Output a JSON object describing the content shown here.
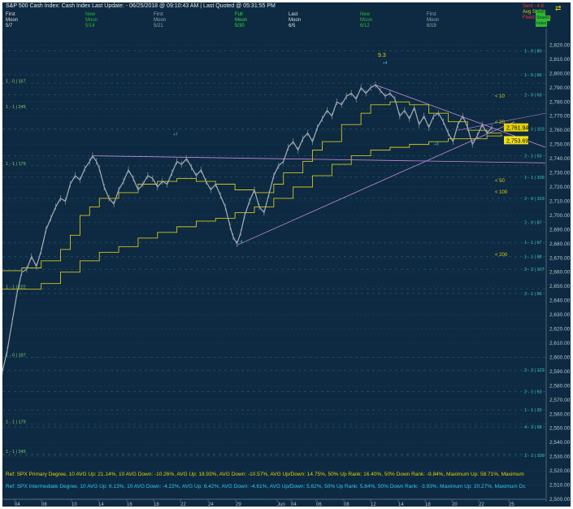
{
  "header": {
    "title": "S&P 500 Cash Index:  Cash Index  Last Update:  - 06/25/2018 @ 09:10:43 AM | Last Quoted @ 05:31:55 PM",
    "moon_phases": [
      {
        "top": "First",
        "bottom": "Moon",
        "date": "5/7",
        "color": "#e0e0e0"
      },
      {
        "top": "New",
        "bottom": "Moon",
        "date": "5/14",
        "color": "#2eb82e"
      },
      {
        "top": "First",
        "bottom": "Moon",
        "date": "5/21",
        "color": "#9aa4ad"
      },
      {
        "top": "Full",
        "bottom": "Moon",
        "date": "5/30",
        "color": "#33dd33"
      },
      {
        "top": "Last",
        "bottom": "Moon",
        "date": "6/5",
        "color": "#e0e0e0"
      },
      {
        "top": "New",
        "bottom": "Moon",
        "date": "6/12",
        "color": "#2eb82e"
      },
      {
        "top": "First",
        "bottom": "Moon",
        "date": "6/19",
        "color": "#9aa4ad"
      }
    ],
    "legend": [
      {
        "label": "Sent - 4.8",
        "color": "#ff3333"
      },
      {
        "label": "Avg  Shift",
        "color": "#e6d200"
      },
      {
        "label": "Fixed Shares",
        "color": "#ff3333"
      }
    ],
    "legend_badges": [
      "Shift",
      "Shares",
      "Index"
    ]
  },
  "annotations": {
    "peak_label": "9.3",
    "marker_high": "+4",
    "marker_left": "+7",
    "marker_low": "-4",
    "marker_right": "+3",
    "ma_labels": [
      "< 10",
      "< 20",
      "< 50",
      "< 100",
      "< 200"
    ]
  },
  "levels": [
    {
      "label": "1 - 0 | 80",
      "price": 2816
    },
    {
      "label": "1 - 0 | 66",
      "price": 2799
    },
    {
      "label": "2 - 0 | 63",
      "price": 2785
    },
    {
      "label": "2 - 1 | 102",
      "price": 2761
    },
    {
      "label": "2 - 1 | 53",
      "price": 2742
    },
    {
      "label": "1 - 1 | 106",
      "price": 2727
    },
    {
      "label": "2 - 0 | 103",
      "price": 2712
    },
    {
      "label": "2 - 0 | 87",
      "price": 2695
    },
    {
      "label": "1 - 1 | 67",
      "price": 2681
    },
    {
      "label": "1 - 1 | 88",
      "price": 2671
    },
    {
      "label": "2 - 2 | 107",
      "price": 2662
    },
    {
      "label": "2 - 1 | 56",
      "price": 2645
    },
    {
      "label": "2 - 2 | 122",
      "price": 2591
    },
    {
      "label": "2 - 1 | 63",
      "price": 2576
    },
    {
      "label": "1 - 1 | 33",
      "price": 2563
    },
    {
      "label": "4 - 3 | 58",
      "price": 2551
    },
    {
      "label": "1 - 1 | 106",
      "price": 2531
    }
  ],
  "left_levels": [
    {
      "label": "1 - 0 | 167",
      "price": 2793
    },
    {
      "label": "1 - 1 | 245",
      "price": 2775
    },
    {
      "label": "1 - 1 | 179",
      "price": 2735
    },
    {
      "label": "1 - 1 | 222",
      "price": 2648
    },
    {
      "label": "1 - 0 | 197",
      "price": 2600
    },
    {
      "label": "1 - 1 | 179",
      "price": 2553
    },
    {
      "label": "1 - 1 | 245",
      "price": 2532
    }
  ],
  "stats": {
    "primary": "Ref: SPX Primary Degree, 10 AVG Up: 21.14%, 10 AVG Down: -10.26%, AVG Up: 18.93%, AVG Down: -10.57%, AVG Up/Down: 14.75%, 50%  Up Rank: 16.40%, 50% Down Rank: -9.84%, Maximum Up: 58.71%, Maximum",
    "intermediate": "Ref: SPX Intermediate Degree, 10 AVG Up: 6.13%, 10 AVG Down: -4.22%, AVG Up: 6.42%, AVG Down: -4.61%, AVG Up/Down: 5.62%, 50%  Up Rank: 5.84%, 50% Down Rank: -3.93%, Maximum Up: 20.27%, Maximum Dc"
  },
  "chart_data": {
    "type": "line",
    "title": "S&P 500 Cash Index",
    "xlabel": "",
    "ylabel": "",
    "ylim": [
      2500,
      2830
    ],
    "y_ticks": [
      "2,820.00",
      "2,810.00",
      "2,800.00",
      "2,790.00",
      "2,780.00",
      "2,770.00",
      "2,760.00",
      "2,750.00",
      "2,740.00",
      "2,730.00",
      "2,720.00",
      "2,710.00",
      "2,700.00",
      "2,690.00",
      "2,680.00",
      "2,670.00",
      "2,660.00",
      "2,650.00",
      "2,640.00",
      "2,630.00",
      "2,620.00",
      "2,610.00",
      "2,600.00",
      "2,590.00",
      "2,580.00",
      "2,570.00",
      "2,560.00",
      "2,550.00",
      "2,540.00",
      "2,530.00",
      "2,520.00",
      "2,510.00",
      "2,500.00"
    ],
    "x_ticks": [
      "04",
      "08",
      "10",
      "14",
      "16",
      "18",
      "22",
      "24",
      "29",
      "Jun",
      "04",
      "06",
      "08",
      "12",
      "14",
      "18",
      "20",
      "22",
      "25"
    ],
    "price_labels": {
      "last": "2,761.94",
      "ma": "2,753.69"
    },
    "price_path": [
      [
        0,
        2590
      ],
      [
        0.5,
        2605
      ],
      [
        1,
        2625
      ],
      [
        1.5,
        2645
      ],
      [
        2,
        2660
      ],
      [
        2.5,
        2662
      ],
      [
        3,
        2671
      ],
      [
        3.5,
        2664
      ],
      [
        4,
        2675
      ],
      [
        4.5,
        2690
      ],
      [
        5,
        2698
      ],
      [
        5.5,
        2706
      ],
      [
        6,
        2712
      ],
      [
        6.5,
        2710
      ],
      [
        7,
        2722
      ],
      [
        7.5,
        2728
      ],
      [
        8,
        2725
      ],
      [
        8.5,
        2733
      ],
      [
        9,
        2738
      ],
      [
        9.3,
        2742
      ],
      [
        9.7,
        2738
      ],
      [
        10,
        2733
      ],
      [
        10.5,
        2720
      ],
      [
        11,
        2712
      ],
      [
        11.5,
        2708
      ],
      [
        12,
        2718
      ],
      [
        12.5,
        2724
      ],
      [
        13,
        2732
      ],
      [
        13.5,
        2726
      ],
      [
        14,
        2718
      ],
      [
        14.5,
        2722
      ],
      [
        15,
        2728
      ],
      [
        15.5,
        2726
      ],
      [
        16,
        2720
      ],
      [
        16.5,
        2724
      ],
      [
        17,
        2722
      ],
      [
        17.5,
        2730
      ],
      [
        18,
        2738
      ],
      [
        18.5,
        2736
      ],
      [
        19,
        2740
      ],
      [
        19.5,
        2734
      ],
      [
        20,
        2728
      ],
      [
        20.5,
        2732
      ],
      [
        21,
        2724
      ],
      [
        21.5,
        2718
      ],
      [
        22,
        2722
      ],
      [
        22.5,
        2714
      ],
      [
        23,
        2706
      ],
      [
        23.5,
        2692
      ],
      [
        23.8,
        2685
      ],
      [
        24.2,
        2680
      ],
      [
        24.6,
        2688
      ],
      [
        25,
        2700
      ],
      [
        25.5,
        2710
      ],
      [
        26,
        2718
      ],
      [
        26.5,
        2706
      ],
      [
        27,
        2702
      ],
      [
        27.5,
        2715
      ],
      [
        28,
        2728
      ],
      [
        28.5,
        2735
      ],
      [
        29,
        2738
      ],
      [
        29.5,
        2748
      ],
      [
        30,
        2752
      ],
      [
        30.5,
        2746
      ],
      [
        31,
        2754
      ],
      [
        31.5,
        2758
      ],
      [
        32,
        2752
      ],
      [
        32.5,
        2762
      ],
      [
        33,
        2768
      ],
      [
        33.5,
        2774
      ],
      [
        34,
        2770
      ],
      [
        34.5,
        2780
      ],
      [
        35,
        2778
      ],
      [
        35.5,
        2784
      ],
      [
        36,
        2786
      ],
      [
        36.5,
        2782
      ],
      [
        37,
        2790
      ],
      [
        37.5,
        2786
      ],
      [
        38,
        2790
      ],
      [
        38.5,
        2792
      ],
      [
        39,
        2788
      ],
      [
        39.5,
        2784
      ],
      [
        40,
        2786
      ],
      [
        40.5,
        2782
      ],
      [
        41,
        2770
      ],
      [
        41.5,
        2774
      ],
      [
        42,
        2768
      ],
      [
        42.5,
        2776
      ],
      [
        43,
        2764
      ],
      [
        43.5,
        2770
      ],
      [
        44,
        2762
      ],
      [
        44.5,
        2770
      ],
      [
        45,
        2772
      ],
      [
        45.5,
        2766
      ],
      [
        46,
        2758
      ],
      [
        46.5,
        2752
      ],
      [
        47,
        2764
      ],
      [
        47.5,
        2770
      ],
      [
        48,
        2762
      ],
      [
        48.5,
        2750
      ],
      [
        49,
        2756
      ],
      [
        49.5,
        2764
      ],
      [
        50,
        2758
      ],
      [
        50.5,
        2762
      ]
    ],
    "x_range": [
      0,
      52
    ]
  }
}
